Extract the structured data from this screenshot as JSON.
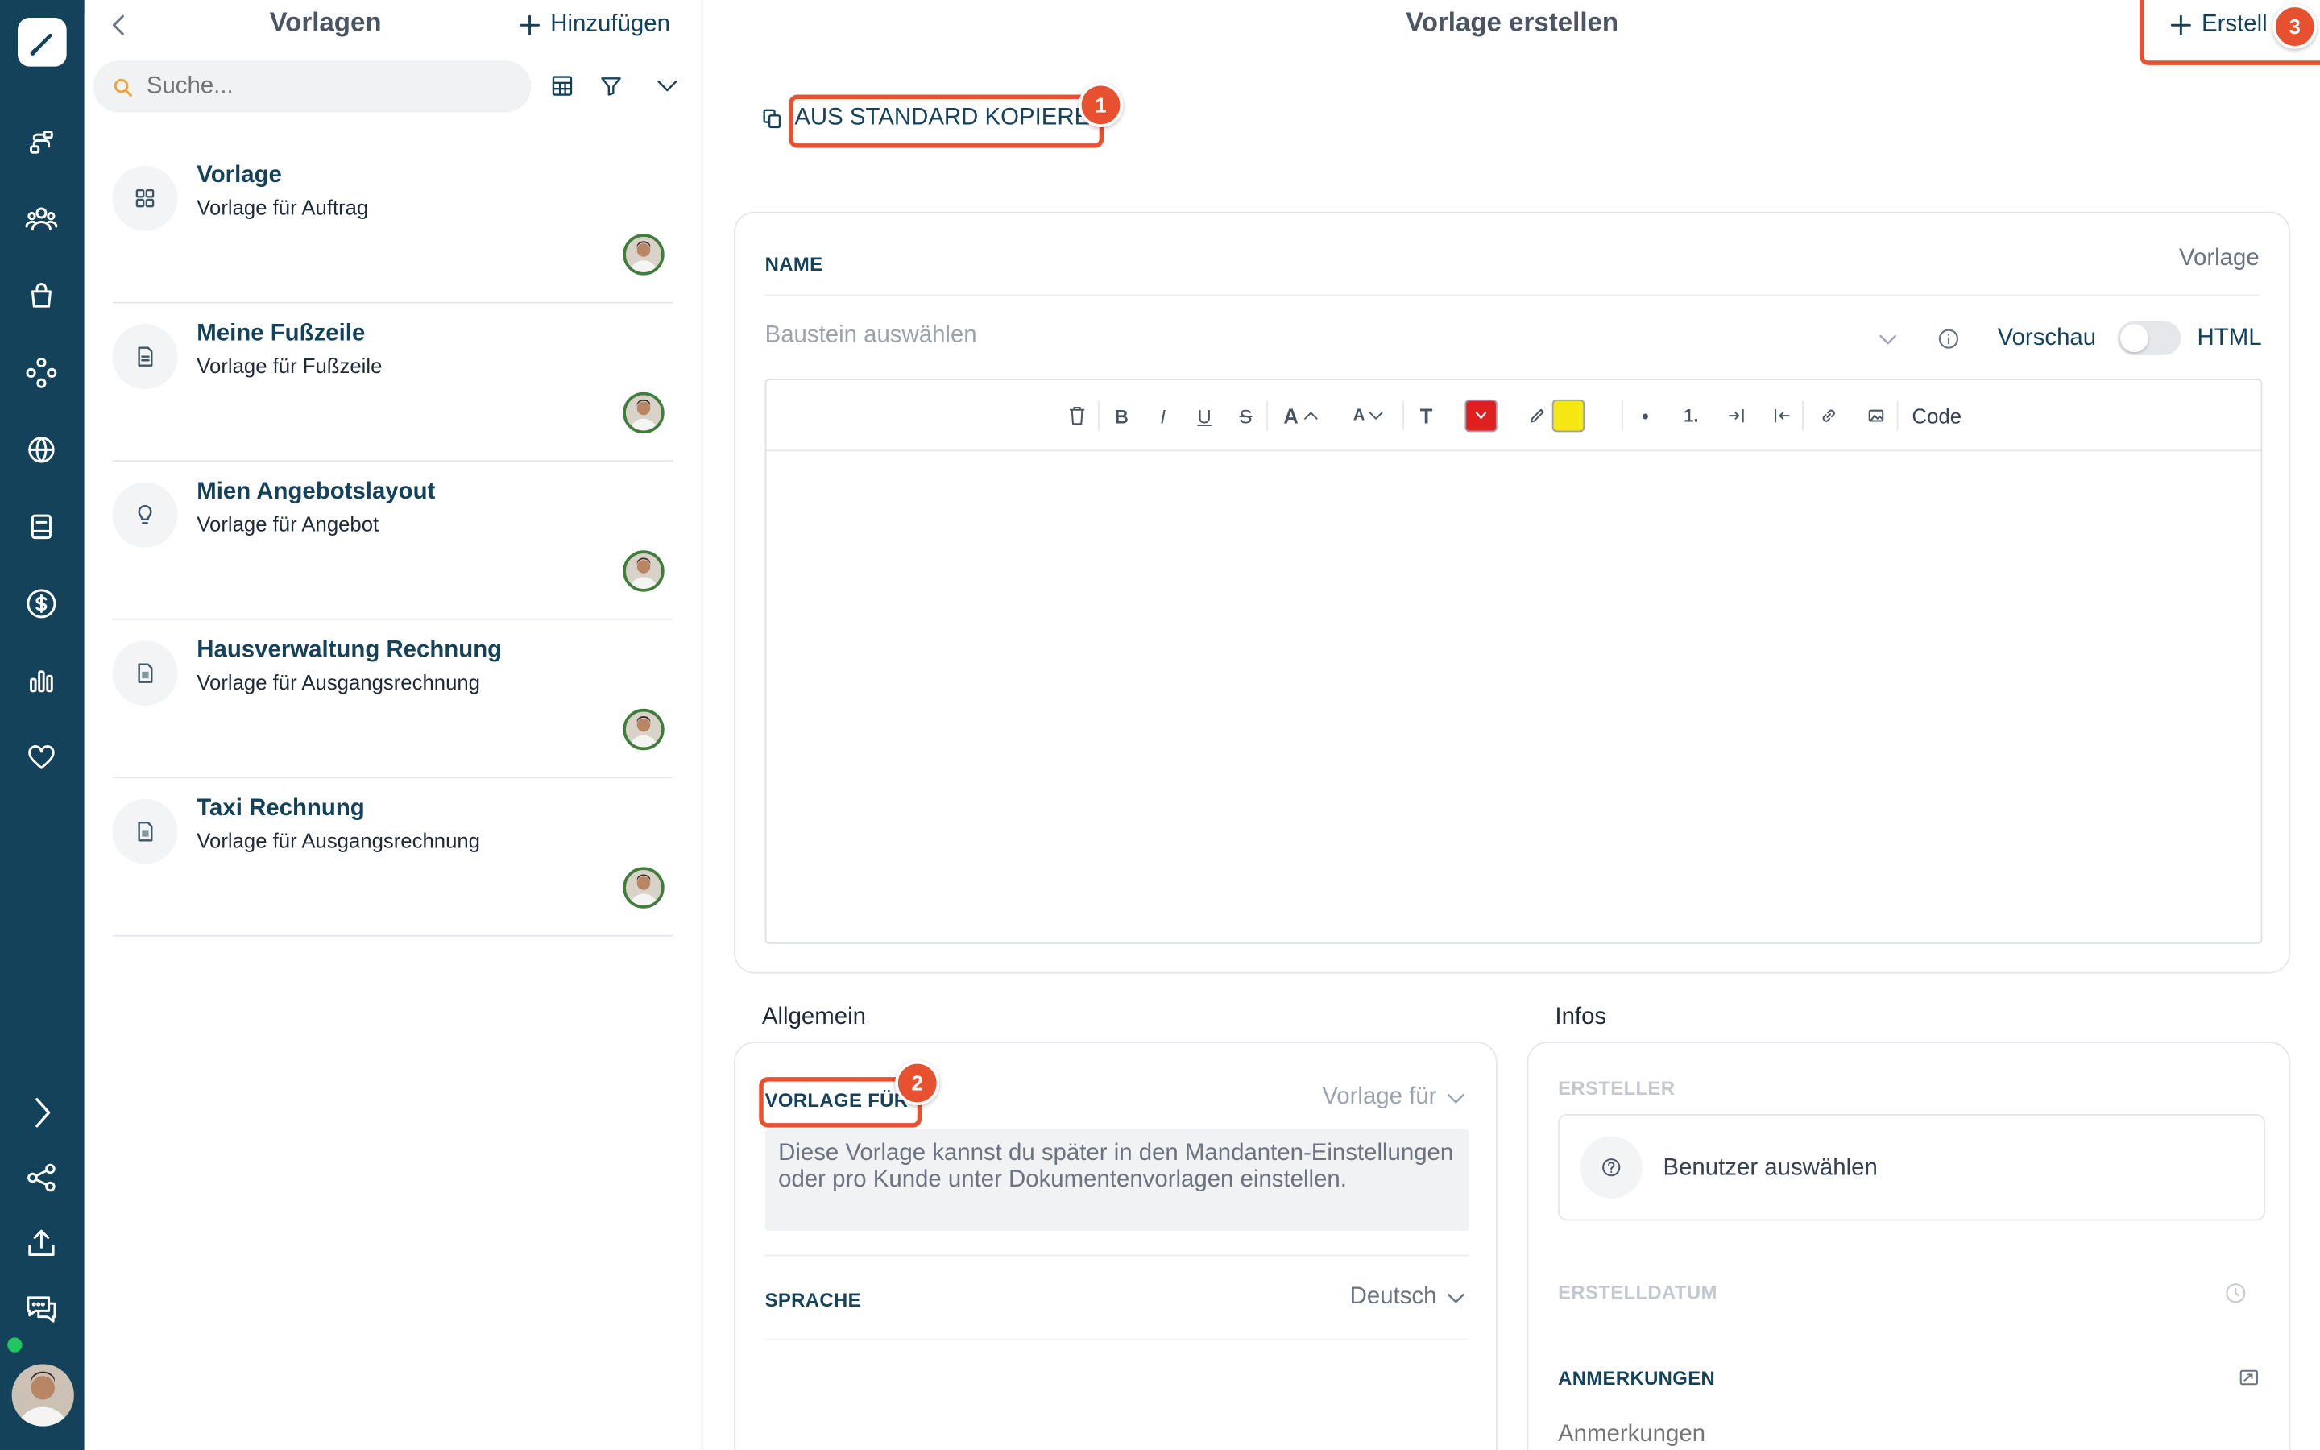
{
  "list": {
    "title": "Vorlagen",
    "add_label": "Hinzufügen",
    "search_placeholder": "Suche...",
    "items": [
      {
        "title": "Vorlage",
        "subtitle": "Vorlage für Auftrag",
        "icon": "grid-icon"
      },
      {
        "title": "Meine Fußzeile",
        "subtitle": "Vorlage für Fußzeile",
        "icon": "document-icon"
      },
      {
        "title": "Mien Angebotslayout",
        "subtitle": "Vorlage für Angebot",
        "icon": "lightbulb-icon"
      },
      {
        "title": "Hausverwaltung Rechnung",
        "subtitle": "Vorlage für Ausgangsrechnung",
        "icon": "invoice-icon"
      },
      {
        "title": "Taxi Rechnung",
        "subtitle": "Vorlage für Ausgangsrechnung",
        "icon": "invoice-icon"
      }
    ]
  },
  "header": {
    "title": "Vorlage erstellen",
    "create_label": "Erstell",
    "copy_label": "AUS STANDARD KOPIEREN"
  },
  "badges": {
    "one": "1",
    "two": "2",
    "three": "3"
  },
  "editor": {
    "name_label": "NAME",
    "name_value": "Vorlage",
    "block_placeholder": "Baustein auswählen",
    "preview_label": "Vorschau",
    "html_label": "HTML",
    "toolbar": {
      "bold": "B",
      "italic": "I",
      "underline": "U",
      "strike": "S",
      "font_size": "A",
      "font_size_small": "A",
      "text": "T",
      "bullet": "•",
      "numbered": "1.",
      "code": "Code"
    }
  },
  "general": {
    "section_title": "Allgemein",
    "template_for_label": "VORLAGE FÜR",
    "template_for_value": "Vorlage für",
    "template_for_hint": "Diese Vorlage kannst du später in den Mandanten-Einstellungen oder pro Kunde unter Dokumentenvorlagen einstellen.",
    "language_label": "SPRACHE",
    "language_value": "Deutsch"
  },
  "infos": {
    "section_title": "Infos",
    "creator_label": "ERSTELLER",
    "user_select": "Benutzer auswählen",
    "created_label": "ERSTELLDATUM",
    "notes_label": "ANMERKUNGEN",
    "notes_placeholder": "Anmerkungen"
  },
  "colors": {
    "rail": "#14425a",
    "accent": "#e8512f",
    "title": "#14425a",
    "font_color_swatch": "#e02020",
    "highlight_swatch": "#f5e614",
    "online": "#22c55e"
  }
}
